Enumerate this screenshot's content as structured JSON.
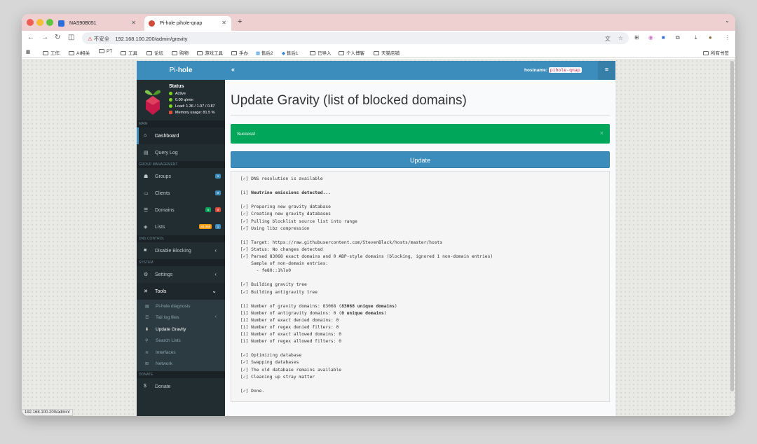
{
  "browser": {
    "tabs": [
      {
        "title": "NAS90B051"
      },
      {
        "title": "Pi-hole pihole-qnap"
      }
    ],
    "security_label": "不安全",
    "url": "192.168.100.200/admin/gravity",
    "bookmarks": [
      "工作",
      "AI相关",
      "PT",
      "工具",
      "论坛",
      "购物",
      "游戏工具",
      "手办",
      "售后2",
      "售后1",
      "已导入",
      "个人博客",
      "天猫店铺"
    ],
    "all_bookmarks": "所有书签",
    "status_url": "192.168.100.200/admin/"
  },
  "sidebar": {
    "logo_pi": "Pi-",
    "logo_hole": "hole",
    "status_title": "Status",
    "status_active": "Active",
    "status_qpm": "0.00 q/min",
    "status_load": "Load: 1.36 / 1.07 / 0.87",
    "status_memory": "Memory usage: 81.5 %",
    "sections": {
      "main": "MAIN",
      "group": "GROUP MANAGEMENT",
      "dns": "DNS CONTROL",
      "system": "SYSTEM",
      "donate": "DONATE"
    },
    "items": {
      "dashboard": "Dashboard",
      "querylog": "Query Log",
      "groups": "Groups",
      "clients": "Clients",
      "domains": "Domains",
      "lists": "Lists",
      "disable": "Disable Blocking",
      "settings": "Settings",
      "tools": "Tools",
      "donate": "Donate"
    },
    "badges": {
      "groups": "1",
      "clients": "0",
      "domains_green": "0",
      "domains_red": "0",
      "lists_yellow": "83,068",
      "lists_blue": "1"
    },
    "tools_sub": {
      "diagnosis": "Pi-hole diagnosis",
      "taillog": "Tail log files",
      "gravity": "Update Gravity",
      "search": "Search Lists",
      "interfaces": "Interfaces",
      "network": "Network"
    }
  },
  "header": {
    "hostname_label": "hostname:",
    "hostname_value": "pihole-qnap"
  },
  "main": {
    "title": "Update Gravity (list of blocked domains)",
    "alert": "Success!",
    "update_button": "Update",
    "output": [
      "[✓] DNS resolution is available",
      "",
      "[i] Neutrino emissions detected...",
      "",
      "[✓] Preparing new gravity database",
      "[✓] Creating new gravity databases",
      "[✓] Pulling blocklist source list into range",
      "[✓] Using libz compression",
      "",
      "[i] Target: https://raw.githubusercontent.com/StevenBlack/hosts/master/hosts",
      "[✓] Status: No changes detected",
      "[✓] Parsed 83068 exact domains and 0 ABP-style domains (blocking, ignored 1 non-domain entries)",
      "    Sample of non-domain entries:",
      "      - fe80::1%lo0",
      "",
      "[✓] Building gravity tree",
      "[✓] Building antigravity tree",
      "",
      "[i] Number of gravity domains: 83068 (83068 unique domains)",
      "[i] Number of antigravity domains: 0 (0 unique domains)",
      "[i] Number of exact denied domains: 0",
      "[i] Number of regex denied filters: 0",
      "[i] Number of exact allowed domains: 0",
      "[i] Number of regex allowed filters: 0",
      "",
      "[✓] Optimizing database",
      "[✓] Swapping databases",
      "[✓] The old database remains available",
      "[✓] Cleaning up stray matter",
      "",
      "[✓] Done."
    ]
  }
}
